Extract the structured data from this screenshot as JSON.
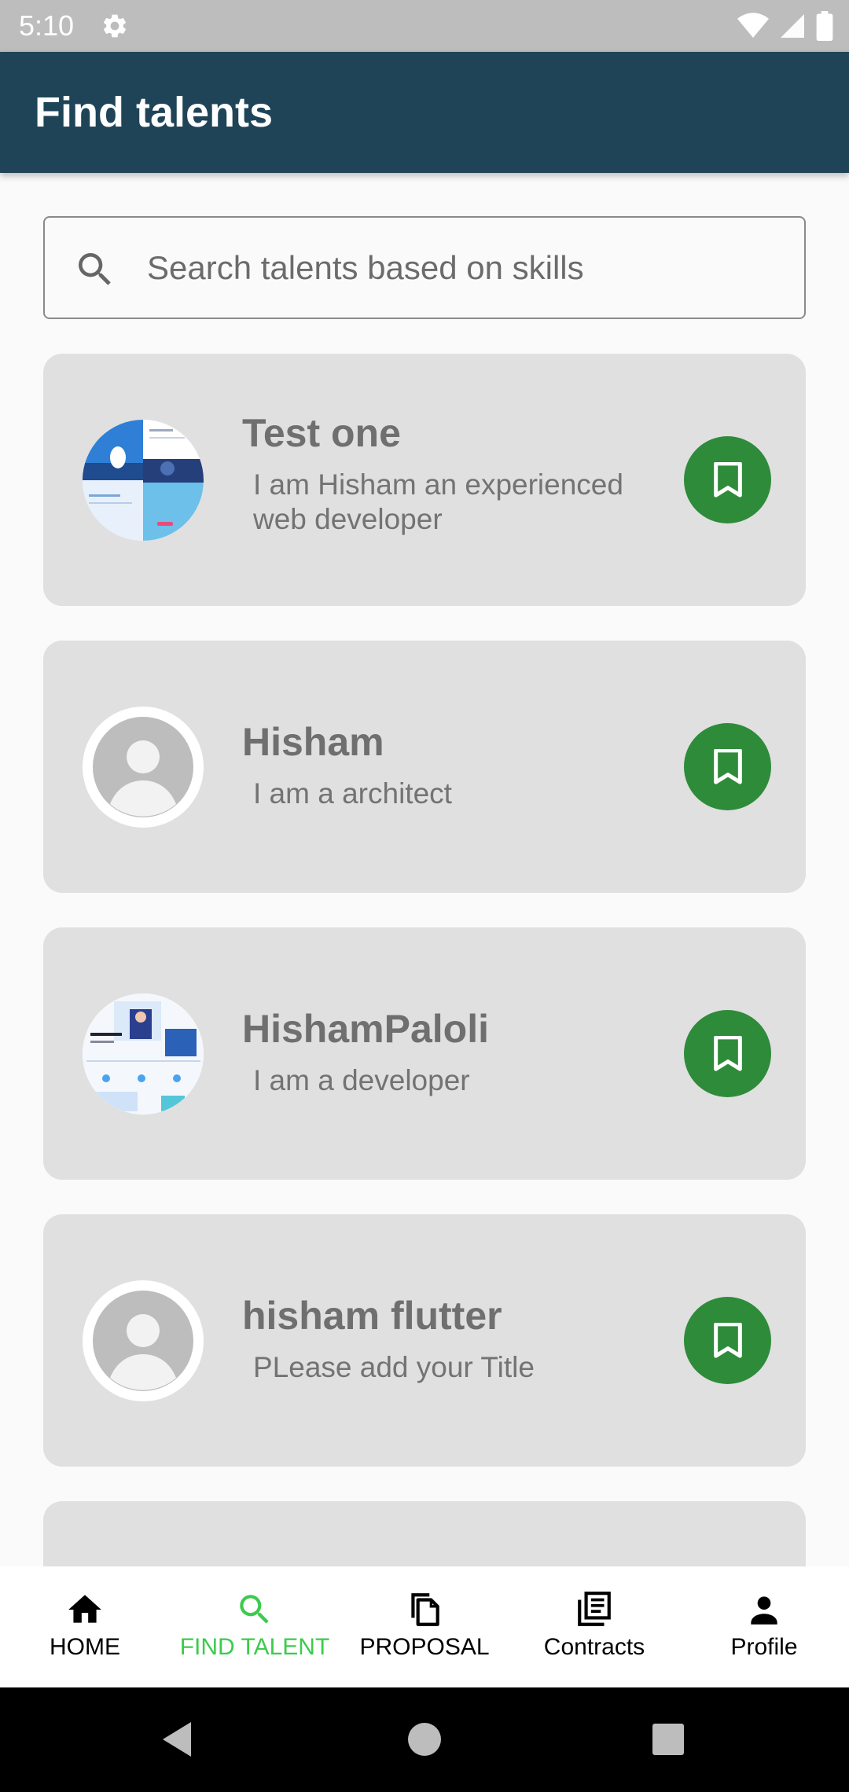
{
  "status_bar": {
    "time": "5:10",
    "icons": [
      "settings-gear-icon",
      "wifi-icon",
      "cell-signal-icon",
      "battery-icon"
    ]
  },
  "app_bar": {
    "title": "Find talents"
  },
  "search": {
    "placeholder": "Search talents based on skills",
    "icon": "search-icon"
  },
  "talents": [
    {
      "name": "Test one",
      "title": "I am Hisham an experienced web developer",
      "avatar": "portfolio-image-avatar"
    },
    {
      "name": "Hisham",
      "title": "I am a architect",
      "avatar": "default-person-avatar"
    },
    {
      "name": "HishamPaloli",
      "title": "I am a developer",
      "avatar": "portfolio-image-avatar"
    },
    {
      "name": "hisham flutter",
      "title": "PLease add your Title",
      "avatar": "default-person-avatar"
    }
  ],
  "bottom_nav": [
    {
      "label": "HOME",
      "icon": "home-icon",
      "active": false
    },
    {
      "label": "FIND TALENT",
      "icon": "search-icon",
      "active": true
    },
    {
      "label": "PROPOSAL",
      "icon": "copy-icon",
      "active": false
    },
    {
      "label": "Contracts",
      "icon": "articles-icon",
      "active": false
    },
    {
      "label": "Profile",
      "icon": "person-icon",
      "active": false
    }
  ],
  "colors": {
    "app_bar": "#1f4457",
    "card": "#e0e0e0",
    "bookmark_button": "#2e8b3a",
    "active_nav": "#3ccb4d"
  }
}
